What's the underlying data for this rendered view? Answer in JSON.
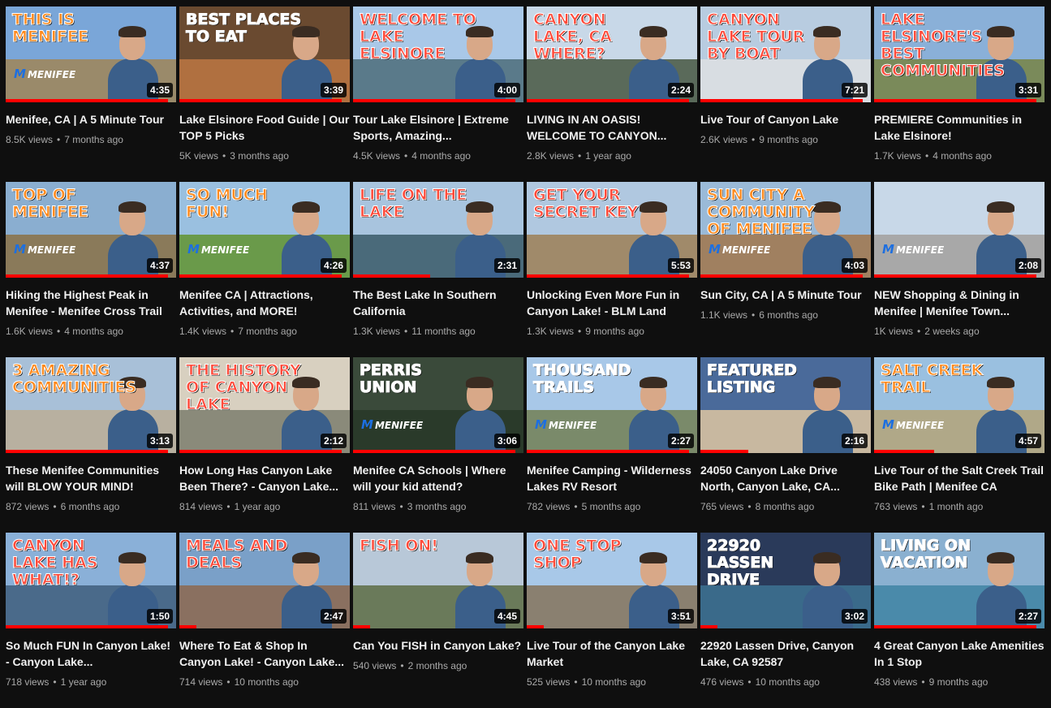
{
  "videos": [
    {
      "title": "Menifee, CA | A 5 Minute Tour",
      "views": "8.5K views",
      "age": "7 months ago",
      "duration": "4:35",
      "headline": "THIS IS MENIFEE",
      "logo": "MENIFEE",
      "progress": 0.95,
      "sky": "#7aa6d8",
      "ground": "#9a8a6a",
      "headline_color": "#ff8a1e"
    },
    {
      "title": "Lake Elsinore Food Guide | Our TOP 5 Picks",
      "views": "5K views",
      "age": "3 months ago",
      "duration": "3:39",
      "headline": "BEST PLACES TO EAT",
      "logo": "",
      "progress": 0.95,
      "sky": "#6a4a30",
      "ground": "#b07040",
      "headline_color": "#ffffff"
    },
    {
      "title": "Tour Lake Elsinore | Extreme Sports, Amazing...",
      "views": "4.5K views",
      "age": "4 months ago",
      "duration": "4:00",
      "headline": "WELCOME TO LAKE ELSINORE",
      "logo": "",
      "progress": 0.95,
      "sky": "#a9c8e8",
      "ground": "#5a7a8a",
      "headline_color": "#ff4a3a"
    },
    {
      "title": "LIVING IN AN OASIS! WELCOME TO CANYON...",
      "views": "2.8K views",
      "age": "1 year ago",
      "duration": "2:24",
      "headline": "CANYON LAKE, CA WHERE?",
      "logo": "",
      "progress": 0.95,
      "sky": "#c8d8e8",
      "ground": "#5a6a5a",
      "headline_color": "#ff4a3a"
    },
    {
      "title": "Live Tour of Canyon Lake",
      "views": "2.6K views",
      "age": "9 months ago",
      "duration": "7:21",
      "headline": "CANYON LAKE TOUR BY BOAT",
      "logo": "",
      "progress": 0.95,
      "sky": "#b8cce0",
      "ground": "#d8dde2",
      "headline_color": "#ff4a3a"
    },
    {
      "title": "PREMIERE Communities in Lake Elsinore!",
      "views": "1.7K views",
      "age": "4 months ago",
      "duration": "3:31",
      "headline": "LAKE ELSINORE'S BEST COMMUNITIES",
      "logo": "",
      "progress": 0.95,
      "sky": "#8ab0d8",
      "ground": "#7a8a5a",
      "headline_color": "#ff4a3a"
    },
    {
      "title": "Hiking the Highest Peak in Menifee - Menifee Cross Trail",
      "views": "1.6K views",
      "age": "4 months ago",
      "duration": "4:37",
      "headline": "TOP OF MENIFEE",
      "logo": "MENIFEE",
      "progress": 0.95,
      "sky": "#8aaed0",
      "ground": "#8a7a5a",
      "headline_color": "#ff8a1e"
    },
    {
      "title": "Menifee CA | Attractions, Activities, and MORE!",
      "views": "1.4K views",
      "age": "7 months ago",
      "duration": "4:26",
      "headline": "SO MUCH FUN!",
      "logo": "MENIFEE",
      "progress": 0.95,
      "sky": "#9ac0e0",
      "ground": "#6a9a4a",
      "headline_color": "#ff8a1e"
    },
    {
      "title": "The Best Lake In Southern California",
      "views": "1.3K views",
      "age": "11 months ago",
      "duration": "2:31",
      "headline": "LIFE ON THE LAKE",
      "logo": "",
      "progress": 0.45,
      "sky": "#a8c4de",
      "ground": "#4a6a7a",
      "headline_color": "#ff4a3a"
    },
    {
      "title": "Unlocking Even More Fun in Canyon Lake! - BLM Land",
      "views": "1.3K views",
      "age": "9 months ago",
      "duration": "5:53",
      "headline": "GET YOUR SECRET KEY",
      "logo": "",
      "progress": 0.95,
      "sky": "#b0c8e0",
      "ground": "#a08a6a",
      "headline_color": "#ff4a3a"
    },
    {
      "title": "Sun City, CA | A 5 Minute Tour",
      "views": "1.1K views",
      "age": "6 months ago",
      "duration": "4:03",
      "headline": "SUN CITY A COMMUNITY OF MENIFEE",
      "logo": "MENIFEE",
      "progress": 0.95,
      "sky": "#9abad8",
      "ground": "#a08060",
      "headline_color": "#ff8a1e"
    },
    {
      "title": "NEW Shopping & Dining in Menifee | Menifee Town...",
      "views": "1K views",
      "age": "2 weeks ago",
      "duration": "2:08",
      "headline": "",
      "logo": "MENIFEE",
      "progress": 0.95,
      "sky": "#c8d8e8",
      "ground": "#a8a8a8",
      "headline_color": "#ff4a3a"
    },
    {
      "title": "These Menifee Communities will BLOW YOUR MIND!",
      "views": "872 views",
      "age": "6 months ago",
      "duration": "3:13",
      "headline": "3 AMAZING COMMUNITIES",
      "logo": "",
      "progress": 0.95,
      "sky": "#a8c0d8",
      "ground": "#b8b0a0",
      "headline_color": "#ff8a1e"
    },
    {
      "title": "How Long Has Canyon Lake Been There? - Canyon Lake...",
      "views": "814 views",
      "age": "1 year ago",
      "duration": "2:12",
      "headline": "THE HISTORY OF CANYON LAKE",
      "logo": "",
      "progress": 0.95,
      "sky": "#d8d0c0",
      "ground": "#8a8a7a",
      "headline_color": "#ff4a3a"
    },
    {
      "title": "Menifee CA Schools | Where will your kid attend?",
      "views": "811 views",
      "age": "3 months ago",
      "duration": "3:06",
      "headline": "PERRIS UNION",
      "logo": "MENIFEE",
      "progress": 0.95,
      "sky": "#3a4a3a",
      "ground": "#2a3a2a",
      "headline_color": "#ffffff"
    },
    {
      "title": "Menifee Camping - Wilderness Lakes RV Resort",
      "views": "782 views",
      "age": "5 months ago",
      "duration": "2:27",
      "headline": "THOUSAND TRAILS",
      "logo": "MENIFEE",
      "progress": 0.95,
      "sky": "#a8c8e8",
      "ground": "#7a8a6a",
      "headline_color": "#ffffff"
    },
    {
      "title": "24050 Canyon Lake Drive North, Canyon Lake, CA...",
      "views": "765 views",
      "age": "8 months ago",
      "duration": "2:16",
      "headline": "FEATURED LISTING",
      "logo": "",
      "progress": 0.28,
      "sky": "#4a6a9a",
      "ground": "#c8b8a0",
      "headline_color": "#ffffff"
    },
    {
      "title": "Live Tour of the Salt Creek Trail Bike Path | Menifee CA",
      "views": "763 views",
      "age": "1 month ago",
      "duration": "4:57",
      "headline": "SALT CREEK TRAIL",
      "logo": "MENIFEE",
      "progress": 0.35,
      "sky": "#9ac0e0",
      "ground": "#b0a888",
      "headline_color": "#ff8a1e"
    },
    {
      "title": "So Much FUN In Canyon Lake! - Canyon Lake...",
      "views": "718 views",
      "age": "1 year ago",
      "duration": "1:50",
      "headline": "CANYON LAKE HAS WHAT!?",
      "logo": "",
      "progress": 0.95,
      "sky": "#8ab0d8",
      "ground": "#4a6a8a",
      "headline_color": "#ff4a3a"
    },
    {
      "title": "Where To Eat & Shop In Canyon Lake! - Canyon Lake...",
      "views": "714 views",
      "age": "10 months ago",
      "duration": "2:47",
      "headline": "MEALS AND DEALS",
      "logo": "",
      "progress": 0.1,
      "sky": "#7aa0c8",
      "ground": "#8a7060",
      "headline_color": "#ff4a3a"
    },
    {
      "title": "Can You FISH in Canyon Lake?",
      "views": "540 views",
      "age": "2 months ago",
      "duration": "4:45",
      "headline": "FISH ON!",
      "logo": "",
      "progress": 0.1,
      "sky": "#b8c8d8",
      "ground": "#6a7a5a",
      "headline_color": "#ff4a3a"
    },
    {
      "title": "Live Tour of the Canyon Lake Market",
      "views": "525 views",
      "age": "10 months ago",
      "duration": "3:51",
      "headline": "ONE STOP SHOP",
      "logo": "",
      "progress": 0.1,
      "sky": "#a8c8e8",
      "ground": "#8a8070",
      "headline_color": "#ff4a3a"
    },
    {
      "title": "22920 Lassen Drive, Canyon Lake, CA 92587",
      "views": "476 views",
      "age": "10 months ago",
      "duration": "3:02",
      "headline": "22920 Lassen Drive",
      "logo": "",
      "progress": 0.1,
      "sky": "#2a3a5a",
      "ground": "#3a6a8a",
      "headline_color": "#ffffff"
    },
    {
      "title": "4 Great Canyon Lake Amenities In 1 Stop",
      "views": "438 views",
      "age": "9 months ago",
      "duration": "2:27",
      "headline": "LIVING ON VACATION",
      "logo": "",
      "progress": 0.95,
      "sky": "#8ab0d0",
      "ground": "#4a8aaa",
      "headline_color": "#ffffff"
    }
  ]
}
